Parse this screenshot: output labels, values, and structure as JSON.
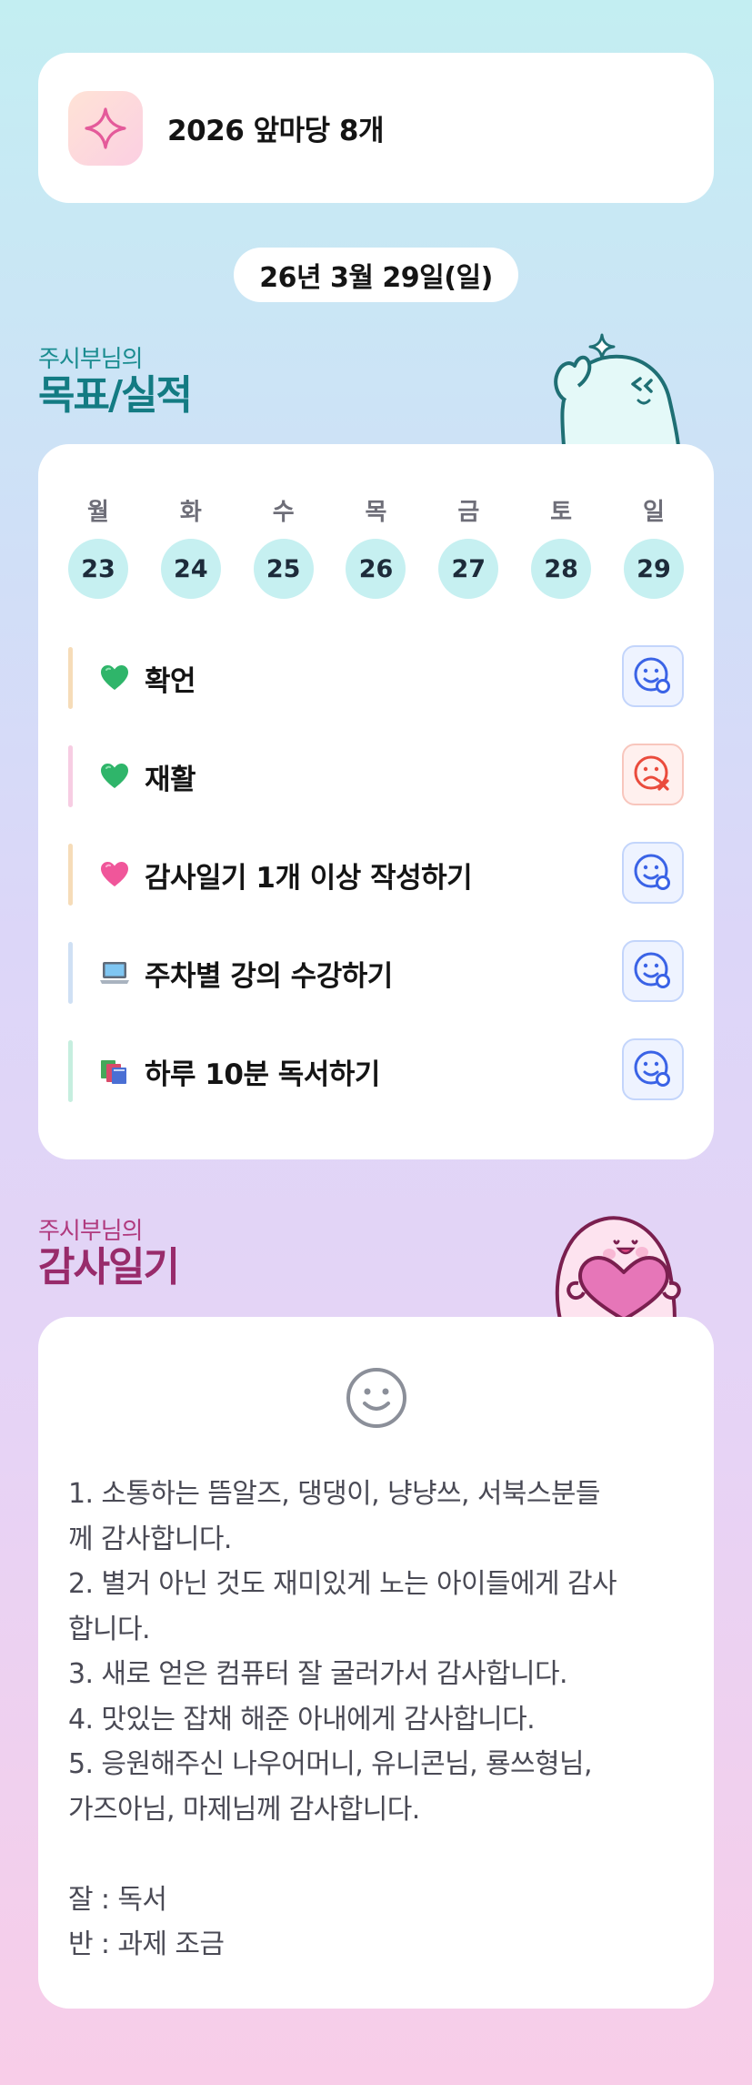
{
  "header": {
    "title": "2026 앞마당 8개",
    "icon": "sparkle-icon"
  },
  "date_label": "26년 3월 29일(일)",
  "goals_section": {
    "subtitle": "주시부님의",
    "title": "목표/실적",
    "accent_color": "#137b83"
  },
  "week": [
    {
      "day": "월",
      "date": "23"
    },
    {
      "day": "화",
      "date": "24"
    },
    {
      "day": "수",
      "date": "25"
    },
    {
      "day": "목",
      "date": "26"
    },
    {
      "day": "금",
      "date": "27"
    },
    {
      "day": "토",
      "date": "28"
    },
    {
      "day": "일",
      "date": "29"
    }
  ],
  "goals": [
    {
      "emoji": "green-heart-icon",
      "label": "확언",
      "bar_color": "#f6dcb8",
      "status": "done"
    },
    {
      "emoji": "green-heart-icon",
      "label": "재활",
      "bar_color": "#f7cde3",
      "status": "missed"
    },
    {
      "emoji": "pink-heart-icon",
      "label": "감사일기 1개 이상 작성하기",
      "bar_color": "#f6dcb8",
      "status": "done"
    },
    {
      "emoji": "laptop-icon",
      "label": "주차별 강의 수강하기",
      "bar_color": "#cfe0f4",
      "status": "done"
    },
    {
      "emoji": "books-icon",
      "label": "하루 10분 독서하기",
      "bar_color": "#c6eedf",
      "status": "done"
    }
  ],
  "gratitude_section": {
    "subtitle": "주시부님의",
    "title": "감사일기",
    "accent_color": "#982b6b"
  },
  "gratitude_text": "1. 소통하는 뜸알즈, 댕댕이, 냥냥쓰, 서북스분들\n께 감사합니다.\n2. 별거 아닌 것도 재미있게 노는 아이들에게 감사\n합니다.\n3. 새로 얻은 컴퓨터 잘 굴러가서 감사합니다.\n4. 맛있는 잡채 해준 아내에게 감사합니다.\n5. 응원해주신 나우어머니, 유니콘님, 룡쓰형님,\n가즈아님, 마제님께 감사합니다.\n\n잘 : 독서\n반 : 과제 조금"
}
